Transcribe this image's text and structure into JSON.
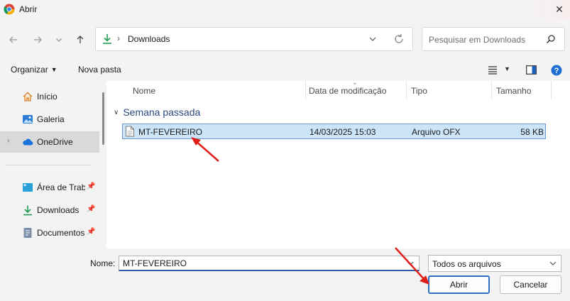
{
  "window": {
    "title": "Abrir"
  },
  "nav": {
    "path_label": "Downloads",
    "search_placeholder": "Pesquisar em Downloads"
  },
  "toolbar": {
    "organize_label": "Organizar",
    "new_folder_label": "Nova pasta"
  },
  "sidebar": {
    "items": [
      {
        "label": "Início",
        "icon": "home-icon"
      },
      {
        "label": "Galeria",
        "icon": "gallery-icon"
      },
      {
        "label": "OneDrive",
        "icon": "cloud-icon",
        "selected": true
      },
      {
        "label": "Área de Trabalho",
        "icon": "desktop-icon",
        "pinned": true
      },
      {
        "label": "Downloads",
        "icon": "download-icon",
        "pinned": true
      },
      {
        "label": "Documentos",
        "icon": "document-icon",
        "pinned": true
      }
    ]
  },
  "columns": {
    "name": "Nome",
    "date": "Data de modificação",
    "type": "Tipo",
    "size": "Tamanho"
  },
  "group": {
    "label": "Semana passada"
  },
  "files": [
    {
      "name": "MT-FEVEREIRO",
      "modified": "14/03/2025 15:03",
      "type": "Arquivo OFX",
      "size": "58 KB",
      "selected": true
    }
  ],
  "footer": {
    "name_label": "Nome:",
    "file_name_value": "MT-FEVEREIRO",
    "file_type_value": "Todos os arquivos",
    "open_label": "Abrir",
    "cancel_label": "Cancelar"
  },
  "colors": {
    "selection_bg": "#cce4f7",
    "selection_border": "#6a9bd1",
    "accent_blue": "#2d6fc2",
    "annotation_red": "#e0201b",
    "download_green": "#1f9d55"
  }
}
